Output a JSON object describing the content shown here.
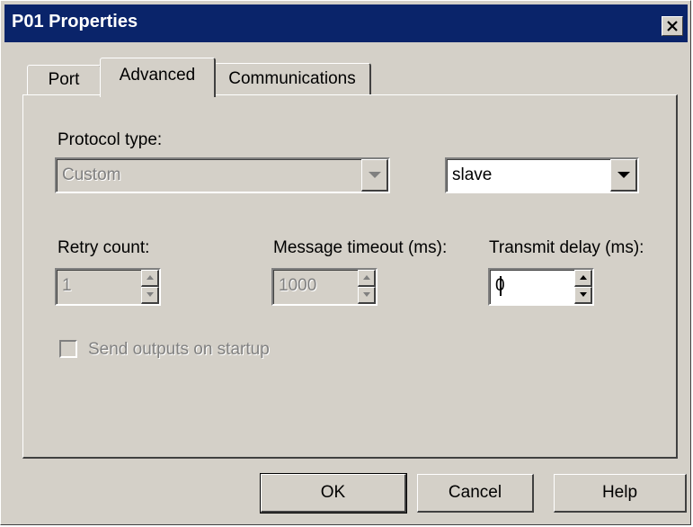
{
  "window": {
    "title": "P01 Properties"
  },
  "tabs": [
    {
      "label": "Port",
      "selected": false
    },
    {
      "label": "Advanced",
      "selected": true
    },
    {
      "label": "Communications",
      "selected": false
    }
  ],
  "protocol": {
    "label": "Protocol type:",
    "value": "Custom",
    "enabled": false,
    "role_value": "slave"
  },
  "retry": {
    "label": "Retry count:",
    "value": "1",
    "enabled": false
  },
  "timeout": {
    "label": "Message timeout (ms):",
    "value": "1000",
    "enabled": false
  },
  "transmit": {
    "label": "Transmit delay (ms):",
    "value": "0",
    "enabled": true
  },
  "startup": {
    "label": "Send outputs on startup",
    "checked": false,
    "enabled": false
  },
  "buttons": {
    "ok": "OK",
    "cancel": "Cancel",
    "help": "Help"
  },
  "colors": {
    "titlebar": "#0a246a",
    "face": "#d4d0c8",
    "disabled_text": "#808080"
  }
}
